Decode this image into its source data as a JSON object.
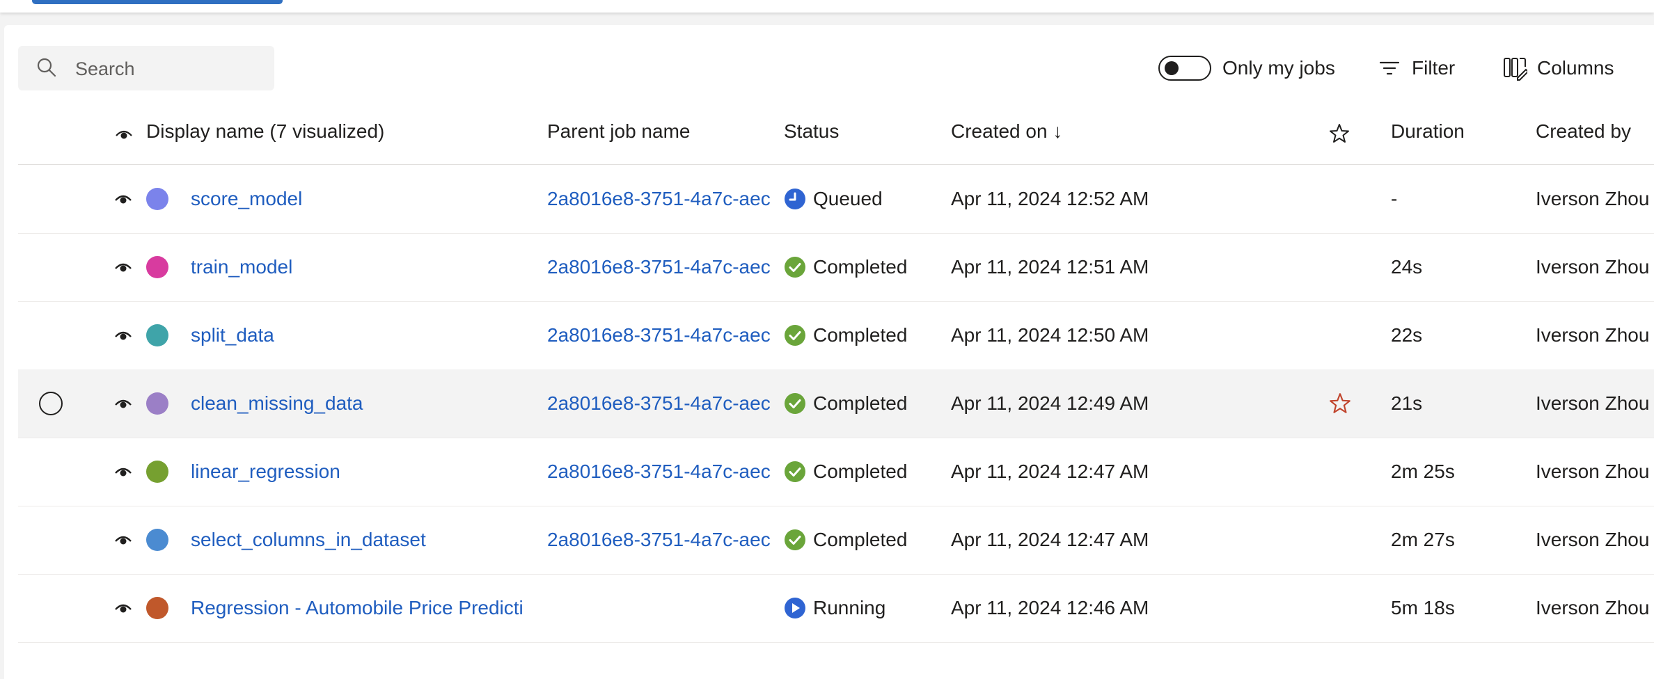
{
  "search": {
    "placeholder": "Search"
  },
  "toolbar": {
    "only_my_jobs_label": "Only my jobs",
    "only_my_jobs_on": false,
    "filter_label": "Filter",
    "columns_label": "Columns"
  },
  "table": {
    "headers": {
      "display_name": "Display name (7 visualized)",
      "parent_job": "Parent job name",
      "status": "Status",
      "created_on": "Created on ↓",
      "duration": "Duration",
      "created_by": "Created by"
    },
    "rows": [
      {
        "name": "score_model",
        "color": "#7b83eb",
        "parent": "2a8016e8-3751-4a7c-aec",
        "status": "Queued",
        "status_icon": "clock-icon",
        "created_on": "Apr 11, 2024 12:52 AM",
        "duration": "-",
        "created_by": "Iverson Zhou"
      },
      {
        "name": "train_model",
        "color": "#d83b9f",
        "parent": "2a8016e8-3751-4a7c-aec",
        "status": "Completed",
        "status_icon": "check-circle-icon",
        "created_on": "Apr 11, 2024 12:51 AM",
        "duration": "24s",
        "created_by": "Iverson Zhou"
      },
      {
        "name": "split_data",
        "color": "#3fa4a9",
        "parent": "2a8016e8-3751-4a7c-aec",
        "status": "Completed",
        "status_icon": "check-circle-icon",
        "created_on": "Apr 11, 2024 12:50 AM",
        "duration": "22s",
        "created_by": "Iverson Zhou"
      },
      {
        "name": "clean_missing_data",
        "color": "#9b7fc6",
        "parent": "2a8016e8-3751-4a7c-aec",
        "status": "Completed",
        "status_icon": "check-circle-icon",
        "created_on": "Apr 11, 2024 12:49 AM",
        "duration": "21s",
        "created_by": "Iverson Zhou"
      },
      {
        "name": "linear_regression",
        "color": "#76a030",
        "parent": "2a8016e8-3751-4a7c-aec",
        "status": "Completed",
        "status_icon": "check-circle-icon",
        "created_on": "Apr 11, 2024 12:47 AM",
        "duration": "2m 25s",
        "created_by": "Iverson Zhou"
      },
      {
        "name": "select_columns_in_dataset",
        "color": "#4b8bd1",
        "parent": "2a8016e8-3751-4a7c-aec",
        "status": "Completed",
        "status_icon": "check-circle-icon",
        "created_on": "Apr 11, 2024 12:47 AM",
        "duration": "2m 27s",
        "created_by": "Iverson Zhou"
      },
      {
        "name": "Regression - Automobile Price Predicti",
        "color": "#c0582b",
        "parent": "",
        "status": "Running",
        "status_icon": "play-circle-icon",
        "created_on": "Apr 11, 2024 12:46 AM",
        "duration": "5m 18s",
        "created_by": "Iverson Zhou"
      }
    ]
  },
  "colors": {
    "link": "#1f5dbf",
    "completed": "#6aa53a",
    "queued_running": "#2f64d2",
    "favorite_star": "#c0432b"
  }
}
